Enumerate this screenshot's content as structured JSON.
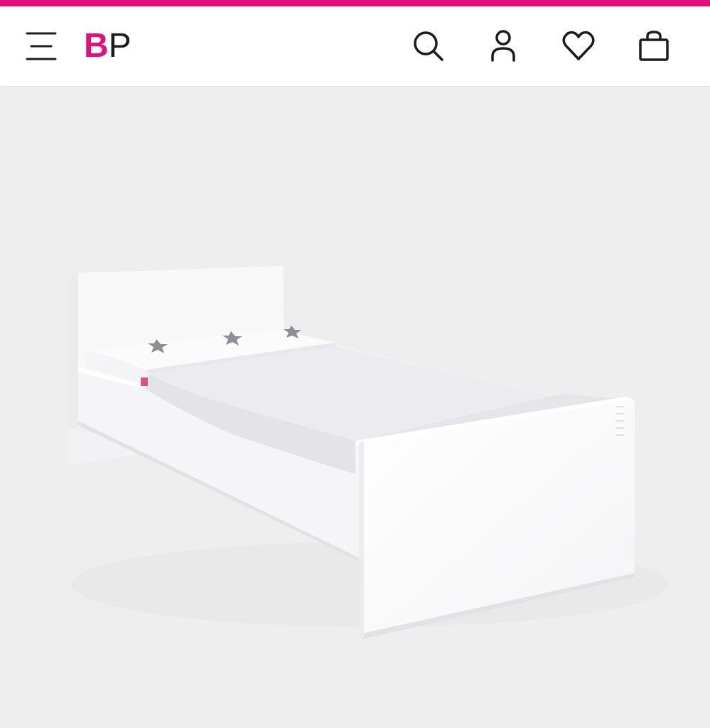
{
  "brand": {
    "logo_bold": "B",
    "logo_regular": "P",
    "accent_color": "#e4107a"
  },
  "header": {
    "icons": [
      "menu-icon",
      "search-icon",
      "account-icon",
      "heart-icon",
      "bag-icon"
    ]
  },
  "product": {
    "image": "white-single-bed-with-star-bedding"
  },
  "colors": {
    "background": "#eeeeee",
    "header_bg": "#ffffff",
    "icon": "#1c1c1c"
  }
}
